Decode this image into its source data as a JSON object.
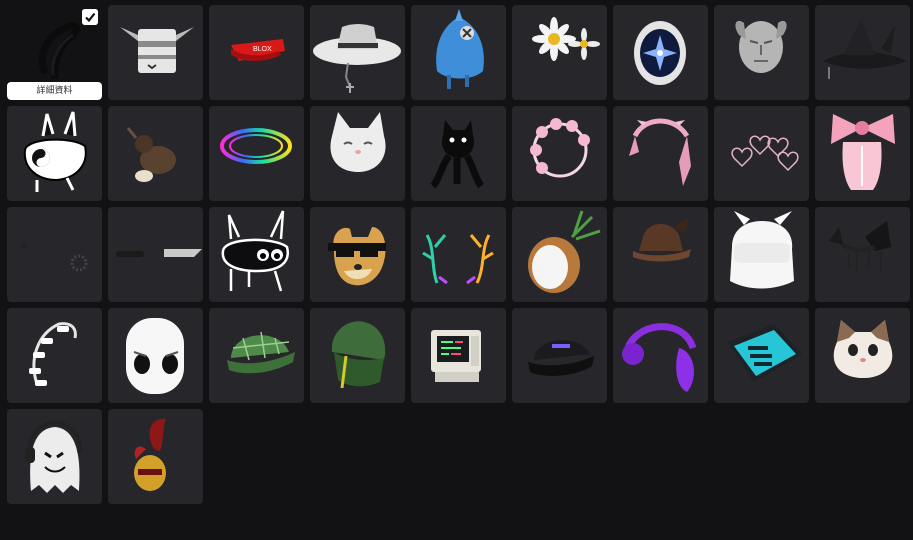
{
  "selected_item": {
    "details_label": "詳細資料",
    "icon": "check-icon"
  },
  "items": [
    {
      "name": "black-hair-selected",
      "icon": "black-hair-icon"
    },
    {
      "name": "spiked-bucket-helmet",
      "icon": "helmet-icon"
    },
    {
      "name": "red-roblox-visor",
      "icon": "visor-icon",
      "text": "BLOX"
    },
    {
      "name": "white-fedora-chain",
      "icon": "white-hat-icon"
    },
    {
      "name": "blue-shark-hood",
      "icon": "blue-hood-icon"
    },
    {
      "name": "daisy-crown",
      "icon": "daisy-icon"
    },
    {
      "name": "star-egg",
      "icon": "egg-icon"
    },
    {
      "name": "stone-face-mask",
      "icon": "stone-mask-icon"
    },
    {
      "name": "black-witch-hat",
      "icon": "witch-hat-icon"
    },
    {
      "name": "yin-yang-creature",
      "icon": "creature-icon"
    },
    {
      "name": "kiwi-bird",
      "icon": "bird-icon"
    },
    {
      "name": "rainbow-halo",
      "icon": "halo-icon"
    },
    {
      "name": "white-cat-head",
      "icon": "cat-head-icon"
    },
    {
      "name": "black-cat",
      "icon": "black-cat-icon"
    },
    {
      "name": "pink-flower-halo",
      "icon": "flower-halo-icon"
    },
    {
      "name": "pink-ribbon-headband",
      "icon": "ribbon-icon"
    },
    {
      "name": "heart-chain",
      "icon": "hearts-icon"
    },
    {
      "name": "pink-bow",
      "icon": "bow-icon"
    },
    {
      "name": "black-earrings",
      "icon": "earrings-icon"
    },
    {
      "name": "knife-through-head",
      "icon": "knife-icon"
    },
    {
      "name": "white-outline-creature",
      "icon": "outline-creature-icon"
    },
    {
      "name": "doge-sunglasses",
      "icon": "doge-icon"
    },
    {
      "name": "rainbow-antlers",
      "icon": "antlers-icon"
    },
    {
      "name": "coconut-head",
      "icon": "coconut-icon"
    },
    {
      "name": "brown-bat-hat",
      "icon": "bat-hat-icon"
    },
    {
      "name": "white-horned-hood",
      "icon": "horned-hood-icon"
    },
    {
      "name": "black-lace-horns",
      "icon": "lace-horns-icon"
    },
    {
      "name": "white-hair-clips",
      "icon": "hair-clips-icon"
    },
    {
      "name": "white-marshmallow-head",
      "icon": "marshmallow-icon"
    },
    {
      "name": "green-plaid-cap",
      "icon": "plaid-cap-icon"
    },
    {
      "name": "green-beanie",
      "icon": "beanie-icon"
    },
    {
      "name": "retro-computer-head",
      "icon": "computer-icon"
    },
    {
      "name": "black-baseball-cap",
      "icon": "black-cap-icon"
    },
    {
      "name": "purple-headphones",
      "icon": "headphones-icon"
    },
    {
      "name": "book-sign-hat",
      "icon": "book-icon"
    },
    {
      "name": "cat-meme-head",
      "icon": "cat-meme-icon"
    },
    {
      "name": "ghost-headphones",
      "icon": "ghost-icon"
    },
    {
      "name": "red-feather-helmet",
      "icon": "feather-helmet-icon"
    }
  ],
  "colors": {
    "background": "#121215",
    "tile": "#26262b",
    "details_button": "#ffffff"
  }
}
